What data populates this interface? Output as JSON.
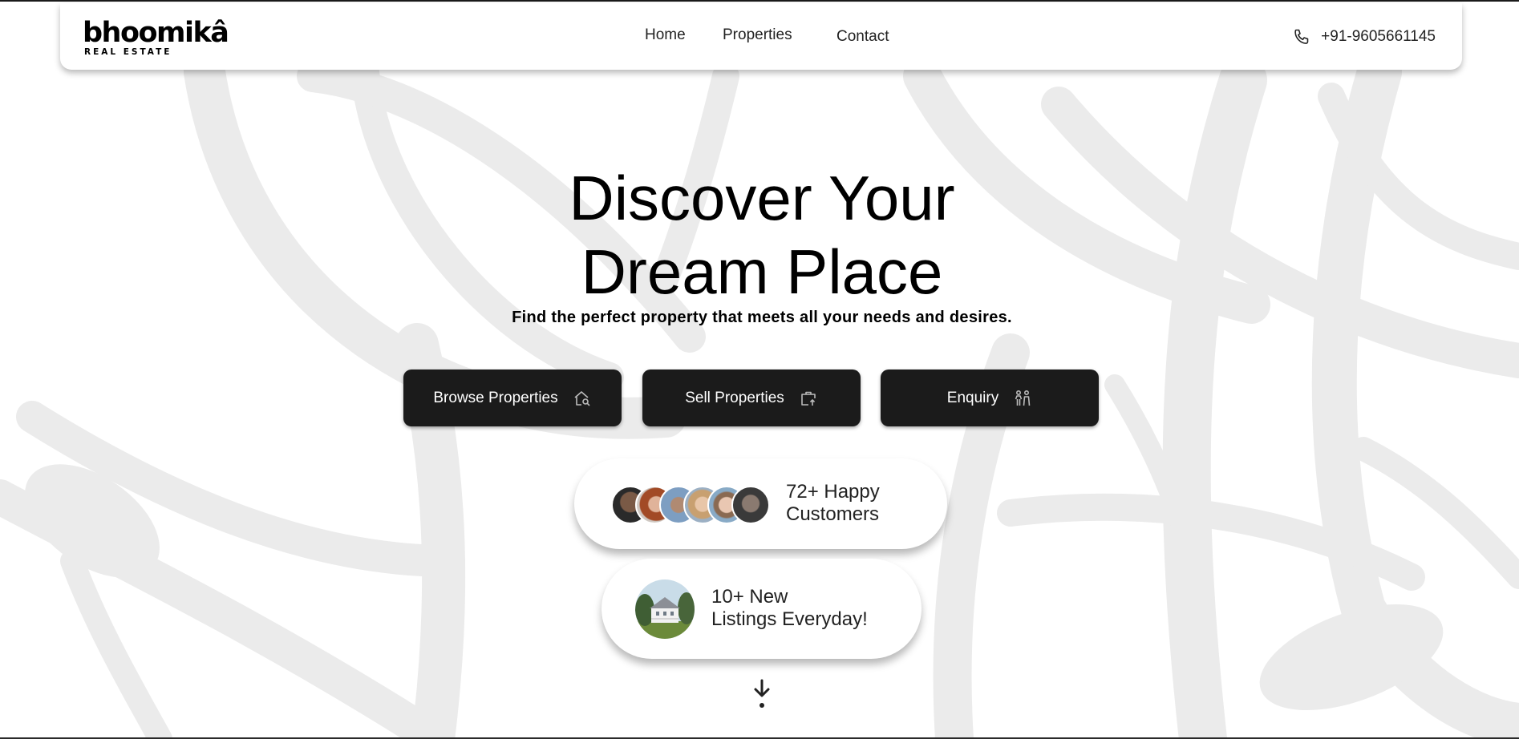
{
  "brand": {
    "name": "bhoomikâ",
    "tagline": "REAL ESTATE"
  },
  "nav": {
    "links": [
      "Home",
      "Properties",
      "Contact"
    ],
    "phone": "+91-9605661145"
  },
  "hero": {
    "title_line1": "Discover Your",
    "title_line2": "Dream Place",
    "subtitle": "Find the perfect property that meets all your needs and desires."
  },
  "actions": [
    {
      "label": "Browse Properties",
      "icon": "home-search-icon"
    },
    {
      "label": "Sell Properties",
      "icon": "briefcase-upload-icon"
    },
    {
      "label": "Enquiry",
      "icon": "people-icon"
    }
  ],
  "stats": {
    "customers_line1": "72+ Happy",
    "customers_line2": "Customers",
    "listings_line1": "10+ New",
    "listings_line2": "Listings Everyday!"
  },
  "colors": {
    "button_bg": "#1b1b1b",
    "background_art": "#ebebeb",
    "text": "#111111"
  }
}
